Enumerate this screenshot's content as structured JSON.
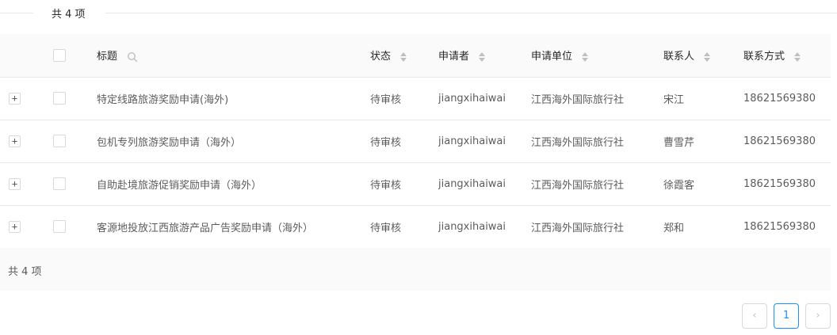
{
  "summary_top": "共 4 项",
  "columns": {
    "title": "标题",
    "status": "状态",
    "applicant": "申请者",
    "unit": "申请单位",
    "contact": "联系人",
    "phone": "联系方式"
  },
  "rows": [
    {
      "expand": "+",
      "title": "特定线路旅游奖励申请(海外)",
      "status": "待审核",
      "applicant": "jiangxihaiwai",
      "unit": "江西海外国际旅行社",
      "contact": "宋江",
      "phone": "18621569380"
    },
    {
      "expand": "+",
      "title": "包机专列旅游奖励申请（海外）",
      "status": "待审核",
      "applicant": "jiangxihaiwai",
      "unit": "江西海外国际旅行社",
      "contact": "曹雪芹",
      "phone": "18621569380"
    },
    {
      "expand": "+",
      "title": "自助赴境旅游促销奖励申请（海外）",
      "status": "待审核",
      "applicant": "jiangxihaiwai",
      "unit": "江西海外国际旅行社",
      "contact": "徐霞客",
      "phone": "18621569380"
    },
    {
      "expand": "+",
      "title": "客源地投放江西旅游产品广告奖励申请（海外）",
      "status": "待审核",
      "applicant": "jiangxihaiwai",
      "unit": "江西海外国际旅行社",
      "contact": "郑和",
      "phone": "18621569380"
    }
  ],
  "footer_summary": "共 4 项",
  "pagination": {
    "prev": "‹",
    "current": "1",
    "next": "›"
  },
  "colors": {
    "accent": "#1890ff",
    "border": "#e8e8e8",
    "header_bg": "#fafafa"
  }
}
